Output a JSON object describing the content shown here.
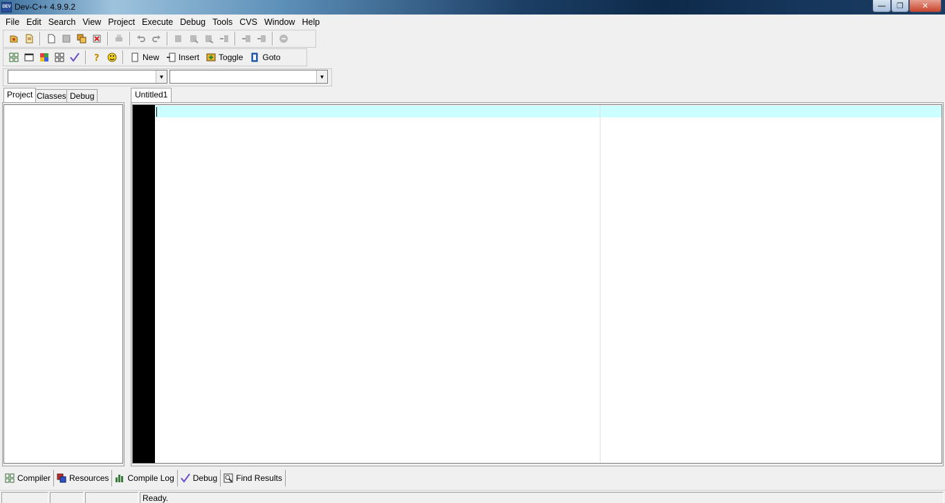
{
  "window": {
    "title": "Dev-C++ 4.9.9.2",
    "app_icon_text": "DEV"
  },
  "menu": [
    "File",
    "Edit",
    "Search",
    "View",
    "Project",
    "Execute",
    "Debug",
    "Tools",
    "CVS",
    "Window",
    "Help"
  ],
  "toolbar2": {
    "new_label": "New",
    "insert_label": "Insert",
    "toggle_label": "Toggle",
    "goto_label": "Goto"
  },
  "left_tabs": [
    "Project",
    "Classes",
    "Debug"
  ],
  "editor": {
    "tab_label": "Untitled1",
    "content": ""
  },
  "bottom_tabs": [
    "Compiler",
    "Resources",
    "Compile Log",
    "Debug",
    "Find Results"
  ],
  "status": {
    "panel1": "",
    "panel2": "",
    "panel3": "",
    "message": "Ready."
  },
  "colors": {
    "gutter": "#000000",
    "current_line": "#ccffff"
  }
}
